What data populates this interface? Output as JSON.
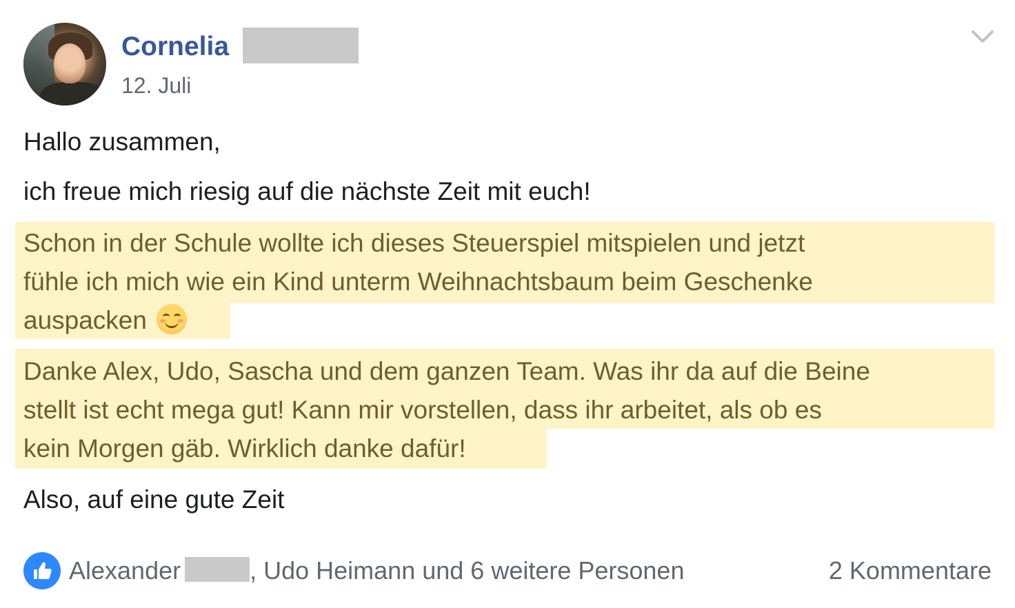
{
  "header": {
    "author_name": "Cornelia",
    "date": "12. Juli"
  },
  "body": {
    "greeting": "Hallo zusammen,",
    "line1": "ich freue mich riesig auf die nächste Zeit mit euch!",
    "highlight1": {
      "lines": [
        "Schon in der Schule wollte ich dieses Steuerspiel mitspielen und jetzt",
        "fühle ich mich wie ein Kind unterm Weihnachtsbaum beim Geschenke",
        "auspacken"
      ],
      "emoji": "smiling-face-emoji"
    },
    "highlight2": {
      "lines": [
        "Danke Alex, Udo, Sascha und dem ganzen Team. Was ihr da auf die Beine",
        "stellt ist echt mega gut! Kann mir vorstellen, dass ihr arbeitet, als ob es",
        "kein Morgen gäb. Wirklich danke dafür!"
      ]
    },
    "closing": "Also, auf eine gute Zeit"
  },
  "footer": {
    "reaction_icon": "like-icon",
    "reactor_first": "Alexander",
    "reactors_rest": ", Udo Heimann und 6 weitere Personen",
    "comments": "2 Kommentare"
  },
  "colors": {
    "author_link": "#385898",
    "highlight_bg": "#fff3c8",
    "highlight_text": "#6b5f2e",
    "like_blue": "#2d88ff",
    "meta_gray": "#616770"
  }
}
